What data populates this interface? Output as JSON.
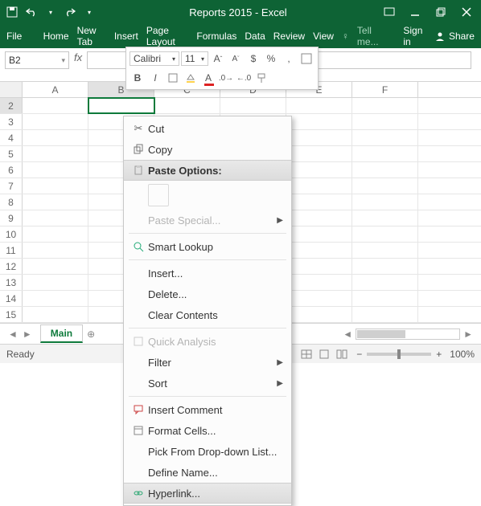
{
  "window": {
    "title": "Reports 2015 - Excel"
  },
  "ribbon": {
    "tabs": [
      "File",
      "Home",
      "New Tab",
      "Insert",
      "Page Layout",
      "Formulas",
      "Data",
      "Review",
      "View"
    ],
    "tellme": "Tell me...",
    "signin": "Sign in",
    "share": "Share"
  },
  "namebox": "B2",
  "mini": {
    "font": "Calibri",
    "size": "11",
    "bold": "B",
    "italic": "I"
  },
  "columns": [
    "A",
    "B",
    "C",
    "D",
    "E",
    "F"
  ],
  "rows": [
    "2",
    "3",
    "4",
    "5",
    "6",
    "7",
    "8",
    "9",
    "10",
    "11",
    "12",
    "13",
    "14",
    "15"
  ],
  "selected": {
    "row": "2",
    "col": "B"
  },
  "sheet": {
    "name": "Main"
  },
  "status": {
    "ready": "Ready",
    "zoom": "100%"
  },
  "context_menu": {
    "cut": "Cut",
    "copy": "Copy",
    "paste_options": "Paste Options:",
    "paste_special": "Paste Special...",
    "smart_lookup": "Smart Lookup",
    "insert": "Insert...",
    "delete": "Delete...",
    "clear": "Clear Contents",
    "quick_analysis": "Quick Analysis",
    "filter": "Filter",
    "sort": "Sort",
    "insert_comment": "Insert Comment",
    "format_cells": "Format Cells...",
    "pick_list": "Pick From Drop-down List...",
    "define_name": "Define Name...",
    "hyperlink": "Hyperlink..."
  }
}
